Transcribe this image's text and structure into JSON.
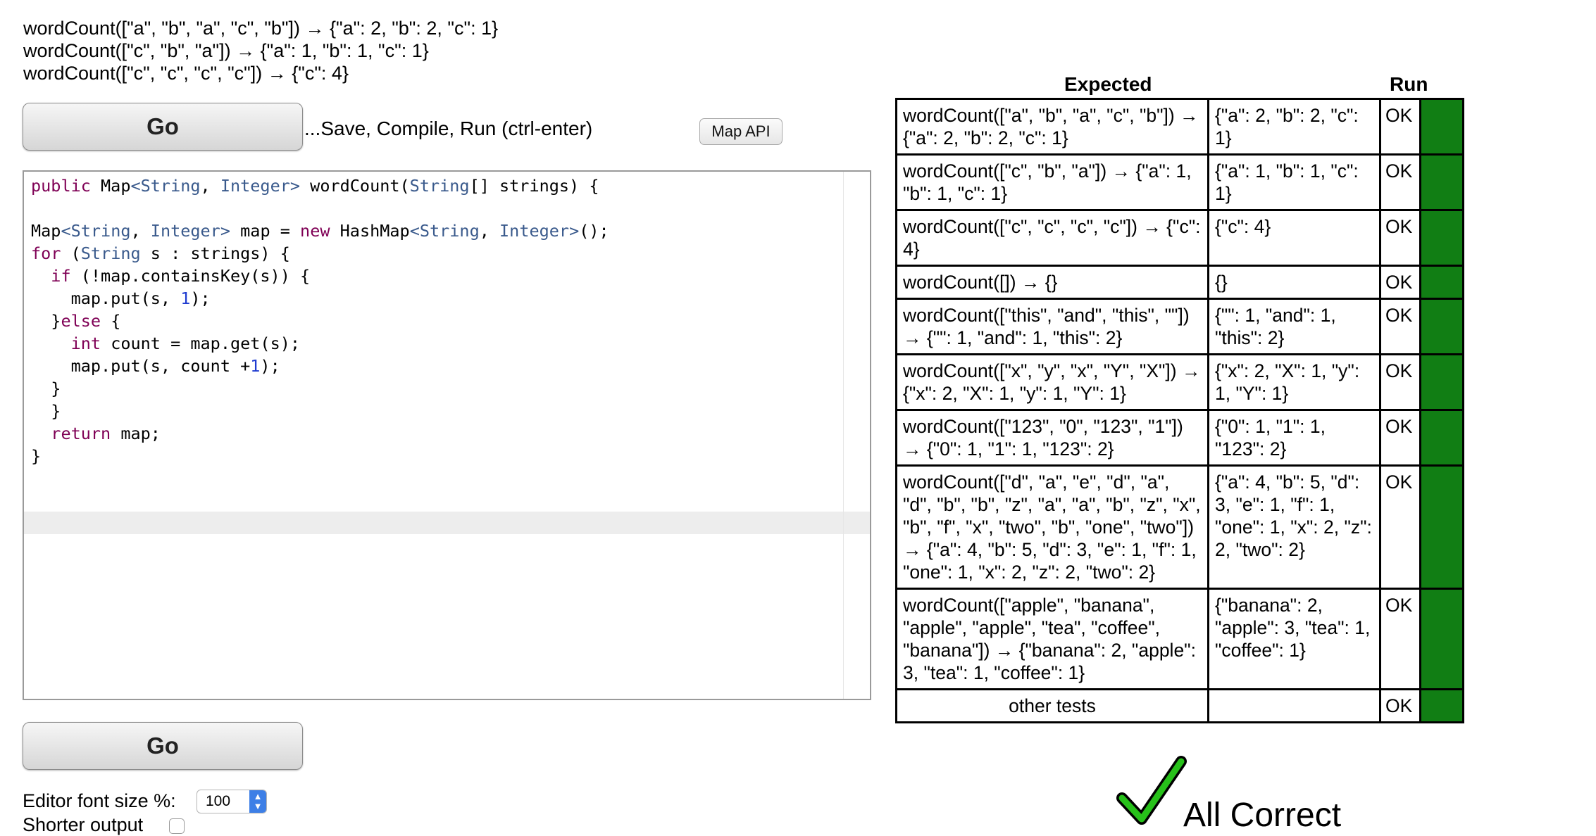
{
  "examples": [
    "wordCount([\"a\", \"b\", \"a\", \"c\", \"b\"]) → {\"a\": 2, \"b\": 2, \"c\": 1}",
    "wordCount([\"c\", \"b\", \"a\"]) → {\"a\": 1, \"b\": 1, \"c\": 1}",
    "wordCount([\"c\", \"c\", \"c\", \"c\"]) → {\"c\": 4}"
  ],
  "toolbar": {
    "go_label": "Go",
    "hint": "...Save, Compile, Run (ctrl-enter)",
    "map_api_label": "Map API"
  },
  "editor": {
    "lines": [
      "public Map<String, Integer> wordCount(String[] strings) {",
      "",
      "Map<String, Integer> map = new HashMap<String, Integer>();",
      "for (String s : strings) {",
      "  if (!map.containsKey(s)) {",
      "    map.put(s, 1);",
      "  }else {",
      "    int count = map.get(s);",
      "    map.put(s, count +1);",
      "  }",
      "  }",
      "  return map;",
      "}"
    ]
  },
  "bottom": {
    "go_label": "Go",
    "font_size_label": "Editor font size %:",
    "font_size_value": "100",
    "shorter_output_label": "Shorter output"
  },
  "results": {
    "headers": {
      "expected": "Expected",
      "run": "Run"
    },
    "status_color": "#117e14",
    "rows": [
      {
        "expected": "wordCount([\"a\", \"b\", \"a\", \"c\", \"b\"]) → {\"a\": 2, \"b\": 2, \"c\": 1}",
        "run": "{\"a\": 2, \"b\": 2, \"c\": 1}",
        "status": "OK"
      },
      {
        "expected": "wordCount([\"c\", \"b\", \"a\"]) → {\"a\": 1, \"b\": 1, \"c\": 1}",
        "run": "{\"a\": 1, \"b\": 1, \"c\": 1}",
        "status": "OK"
      },
      {
        "expected": "wordCount([\"c\", \"c\", \"c\", \"c\"]) → {\"c\": 4}",
        "run": "{\"c\": 4}",
        "status": "OK"
      },
      {
        "expected": "wordCount([]) → {}",
        "run": "{}",
        "status": "OK"
      },
      {
        "expected": "wordCount([\"this\", \"and\", \"this\", \"\"]) → {\"\": 1, \"and\": 1, \"this\": 2}",
        "run": "{\"\": 1, \"and\": 1, \"this\": 2}",
        "status": "OK"
      },
      {
        "expected": "wordCount([\"x\", \"y\", \"x\", \"Y\", \"X\"]) → {\"x\": 2, \"X\": 1, \"y\": 1, \"Y\": 1}",
        "run": "{\"x\": 2, \"X\": 1, \"y\": 1, \"Y\": 1}",
        "status": "OK"
      },
      {
        "expected": "wordCount([\"123\", \"0\", \"123\", \"1\"]) → {\"0\": 1, \"1\": 1, \"123\": 2}",
        "run": "{\"0\": 1, \"1\": 1, \"123\": 2}",
        "status": "OK"
      },
      {
        "expected": "wordCount([\"d\", \"a\", \"e\", \"d\", \"a\", \"d\", \"b\", \"b\", \"z\", \"a\", \"a\", \"b\", \"z\", \"x\", \"b\", \"f\", \"x\", \"two\", \"b\", \"one\", \"two\"]) → {\"a\": 4, \"b\": 5, \"d\": 3, \"e\": 1, \"f\": 1, \"one\": 1, \"x\": 2, \"z\": 2, \"two\": 2}",
        "run": "{\"a\": 4, \"b\": 5, \"d\": 3, \"e\": 1, \"f\": 1, \"one\": 1, \"x\": 2, \"z\": 2, \"two\": 2}",
        "status": "OK"
      },
      {
        "expected": "wordCount([\"apple\", \"banana\", \"apple\", \"apple\", \"tea\", \"coffee\", \"banana\"]) → {\"banana\": 2, \"apple\": 3, \"tea\": 1, \"coffee\": 1}",
        "run": "{\"banana\": 2, \"apple\": 3, \"tea\": 1, \"coffee\": 1}",
        "status": "OK"
      }
    ],
    "other_tests": {
      "label": "other tests",
      "status": "OK"
    }
  },
  "summary": {
    "text": "All Correct",
    "icon": "checkmark-icon"
  }
}
